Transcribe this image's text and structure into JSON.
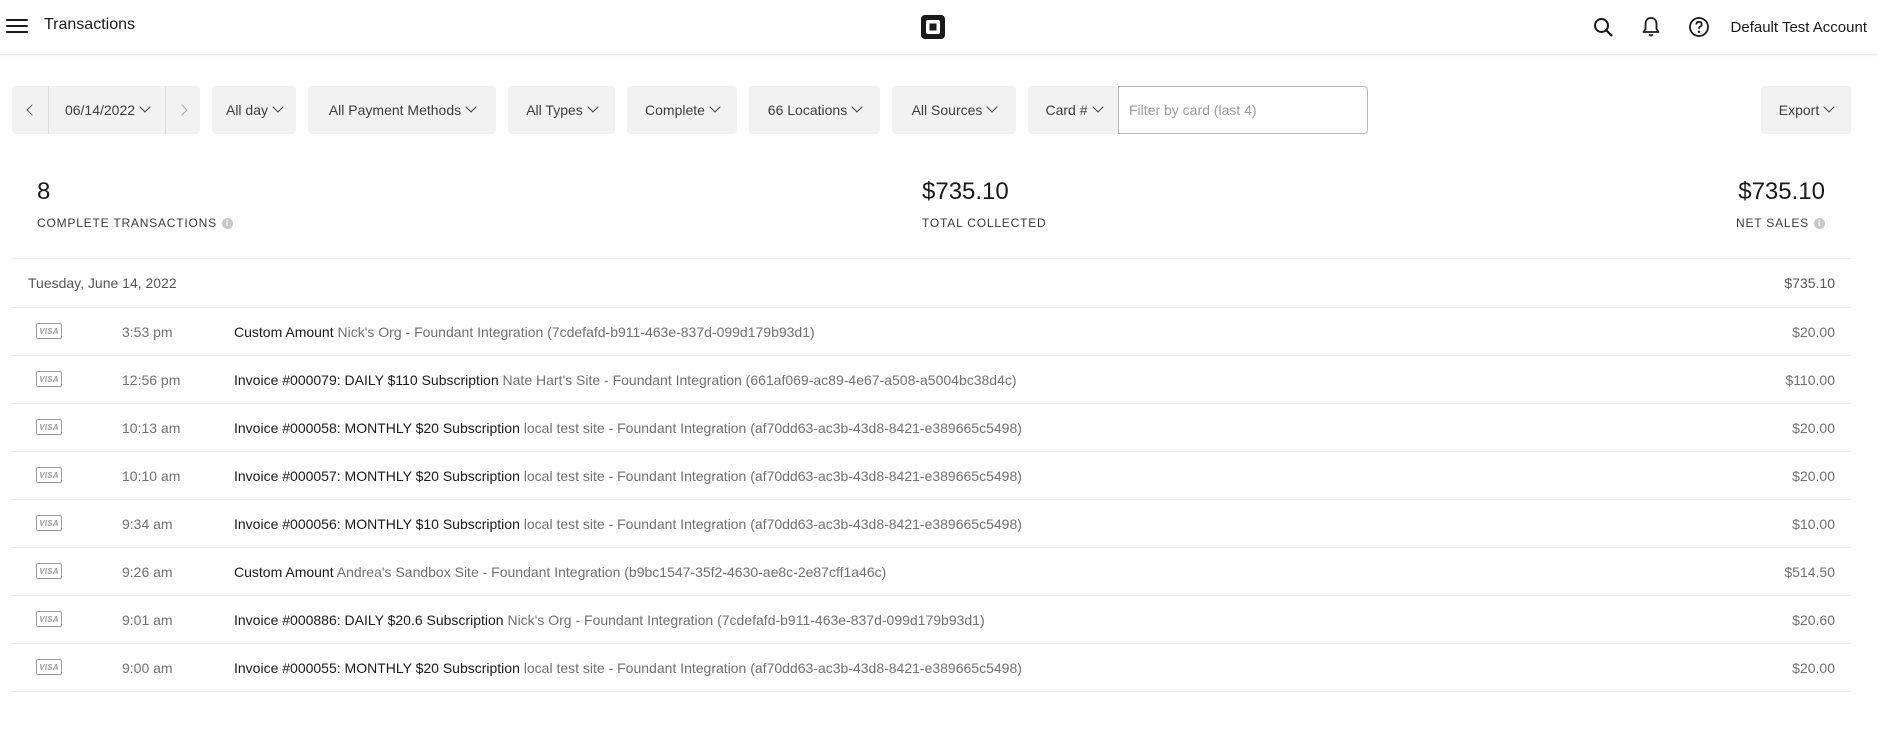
{
  "header": {
    "title": "Transactions",
    "account": "Default Test Account"
  },
  "filters": {
    "date": "06/14/2022",
    "time": "All day",
    "payment_methods": "All Payment Methods",
    "types": "All Types",
    "status": "Complete",
    "locations": "66 Locations",
    "sources": "All Sources",
    "card": "Card #",
    "card_placeholder": "Filter by card (last 4)",
    "export": "Export"
  },
  "summary": {
    "count_value": "8",
    "count_label": "COMPLETE TRANSACTIONS",
    "total_value": "$735.10",
    "total_label": "TOTAL COLLECTED",
    "net_value": "$735.10",
    "net_label": "NET SALES"
  },
  "day_group": {
    "date": "Tuesday, June 14, 2022",
    "total": "$735.10"
  },
  "transactions": [
    {
      "card": "VISA",
      "time": "3:53 pm",
      "title": "Custom Amount",
      "detail": "Nick's Org - Foundant Integration (7cdefafd-b911-463e-837d-099d179b93d1)",
      "amount": "$20.00"
    },
    {
      "card": "VISA",
      "time": "12:56 pm",
      "title": "Invoice #000079: DAILY $110 Subscription",
      "detail": "Nate Hart's Site - Foundant Integration (661af069-ac89-4e67-a508-a5004bc38d4c)",
      "amount": "$110.00"
    },
    {
      "card": "VISA",
      "time": "10:13 am",
      "title": "Invoice #000058: MONTHLY $20 Subscription",
      "detail": "local test site - Foundant Integration (af70dd63-ac3b-43d8-8421-e389665c5498)",
      "amount": "$20.00"
    },
    {
      "card": "VISA",
      "time": "10:10 am",
      "title": "Invoice #000057: MONTHLY $20 Subscription",
      "detail": "local test site - Foundant Integration (af70dd63-ac3b-43d8-8421-e389665c5498)",
      "amount": "$20.00"
    },
    {
      "card": "VISA",
      "time": "9:34 am",
      "title": "Invoice #000056: MONTHLY $10 Subscription",
      "detail": "local test site - Foundant Integration (af70dd63-ac3b-43d8-8421-e389665c5498)",
      "amount": "$10.00"
    },
    {
      "card": "VISA",
      "time": "9:26 am",
      "title": "Custom Amount",
      "detail": "Andrea's Sandbox Site - Foundant Integration (b9bc1547-35f2-4630-ae8c-2e87cff1a46c)",
      "amount": "$514.50"
    },
    {
      "card": "VISA",
      "time": "9:01 am",
      "title": "Invoice #000886: DAILY $20.6 Subscription",
      "detail": "Nick's Org - Foundant Integration (7cdefafd-b911-463e-837d-099d179b93d1)",
      "amount": "$20.60"
    },
    {
      "card": "VISA",
      "time": "9:00 am",
      "title": "Invoice #000055: MONTHLY $20 Subscription",
      "detail": "local test site - Foundant Integration (af70dd63-ac3b-43d8-8421-e389665c5498)",
      "amount": "$20.00"
    }
  ]
}
